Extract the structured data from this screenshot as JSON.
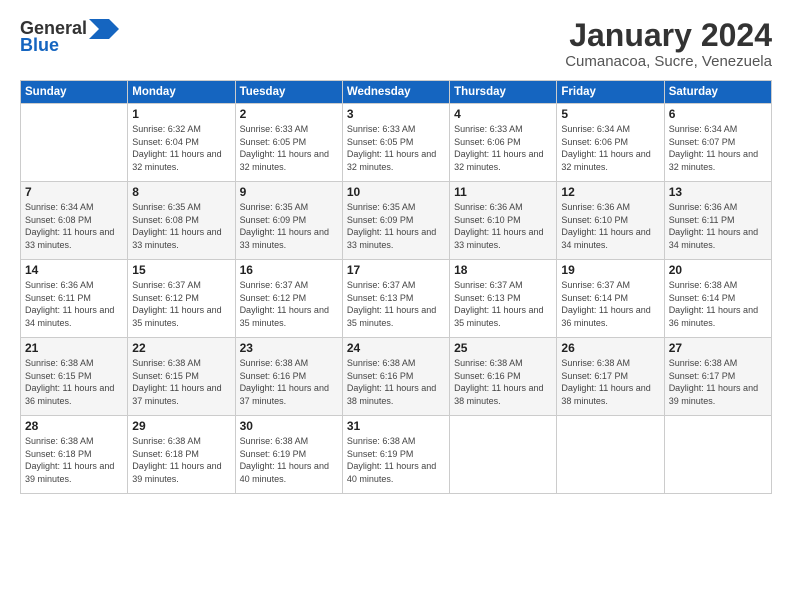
{
  "logo": {
    "general": "General",
    "blue": "Blue"
  },
  "title": "January 2024",
  "location": "Cumanacoa, Sucre, Venezuela",
  "days_of_week": [
    "Sunday",
    "Monday",
    "Tuesday",
    "Wednesday",
    "Thursday",
    "Friday",
    "Saturday"
  ],
  "weeks": [
    [
      {
        "day": "",
        "sunrise": "",
        "sunset": "",
        "daylight": ""
      },
      {
        "day": "1",
        "sunrise": "Sunrise: 6:32 AM",
        "sunset": "Sunset: 6:04 PM",
        "daylight": "Daylight: 11 hours and 32 minutes."
      },
      {
        "day": "2",
        "sunrise": "Sunrise: 6:33 AM",
        "sunset": "Sunset: 6:05 PM",
        "daylight": "Daylight: 11 hours and 32 minutes."
      },
      {
        "day": "3",
        "sunrise": "Sunrise: 6:33 AM",
        "sunset": "Sunset: 6:05 PM",
        "daylight": "Daylight: 11 hours and 32 minutes."
      },
      {
        "day": "4",
        "sunrise": "Sunrise: 6:33 AM",
        "sunset": "Sunset: 6:06 PM",
        "daylight": "Daylight: 11 hours and 32 minutes."
      },
      {
        "day": "5",
        "sunrise": "Sunrise: 6:34 AM",
        "sunset": "Sunset: 6:06 PM",
        "daylight": "Daylight: 11 hours and 32 minutes."
      },
      {
        "day": "6",
        "sunrise": "Sunrise: 6:34 AM",
        "sunset": "Sunset: 6:07 PM",
        "daylight": "Daylight: 11 hours and 32 minutes."
      }
    ],
    [
      {
        "day": "7",
        "sunrise": "Sunrise: 6:34 AM",
        "sunset": "Sunset: 6:08 PM",
        "daylight": "Daylight: 11 hours and 33 minutes."
      },
      {
        "day": "8",
        "sunrise": "Sunrise: 6:35 AM",
        "sunset": "Sunset: 6:08 PM",
        "daylight": "Daylight: 11 hours and 33 minutes."
      },
      {
        "day": "9",
        "sunrise": "Sunrise: 6:35 AM",
        "sunset": "Sunset: 6:09 PM",
        "daylight": "Daylight: 11 hours and 33 minutes."
      },
      {
        "day": "10",
        "sunrise": "Sunrise: 6:35 AM",
        "sunset": "Sunset: 6:09 PM",
        "daylight": "Daylight: 11 hours and 33 minutes."
      },
      {
        "day": "11",
        "sunrise": "Sunrise: 6:36 AM",
        "sunset": "Sunset: 6:10 PM",
        "daylight": "Daylight: 11 hours and 33 minutes."
      },
      {
        "day": "12",
        "sunrise": "Sunrise: 6:36 AM",
        "sunset": "Sunset: 6:10 PM",
        "daylight": "Daylight: 11 hours and 34 minutes."
      },
      {
        "day": "13",
        "sunrise": "Sunrise: 6:36 AM",
        "sunset": "Sunset: 6:11 PM",
        "daylight": "Daylight: 11 hours and 34 minutes."
      }
    ],
    [
      {
        "day": "14",
        "sunrise": "Sunrise: 6:36 AM",
        "sunset": "Sunset: 6:11 PM",
        "daylight": "Daylight: 11 hours and 34 minutes."
      },
      {
        "day": "15",
        "sunrise": "Sunrise: 6:37 AM",
        "sunset": "Sunset: 6:12 PM",
        "daylight": "Daylight: 11 hours and 35 minutes."
      },
      {
        "day": "16",
        "sunrise": "Sunrise: 6:37 AM",
        "sunset": "Sunset: 6:12 PM",
        "daylight": "Daylight: 11 hours and 35 minutes."
      },
      {
        "day": "17",
        "sunrise": "Sunrise: 6:37 AM",
        "sunset": "Sunset: 6:13 PM",
        "daylight": "Daylight: 11 hours and 35 minutes."
      },
      {
        "day": "18",
        "sunrise": "Sunrise: 6:37 AM",
        "sunset": "Sunset: 6:13 PM",
        "daylight": "Daylight: 11 hours and 35 minutes."
      },
      {
        "day": "19",
        "sunrise": "Sunrise: 6:37 AM",
        "sunset": "Sunset: 6:14 PM",
        "daylight": "Daylight: 11 hours and 36 minutes."
      },
      {
        "day": "20",
        "sunrise": "Sunrise: 6:38 AM",
        "sunset": "Sunset: 6:14 PM",
        "daylight": "Daylight: 11 hours and 36 minutes."
      }
    ],
    [
      {
        "day": "21",
        "sunrise": "Sunrise: 6:38 AM",
        "sunset": "Sunset: 6:15 PM",
        "daylight": "Daylight: 11 hours and 36 minutes."
      },
      {
        "day": "22",
        "sunrise": "Sunrise: 6:38 AM",
        "sunset": "Sunset: 6:15 PM",
        "daylight": "Daylight: 11 hours and 37 minutes."
      },
      {
        "day": "23",
        "sunrise": "Sunrise: 6:38 AM",
        "sunset": "Sunset: 6:16 PM",
        "daylight": "Daylight: 11 hours and 37 minutes."
      },
      {
        "day": "24",
        "sunrise": "Sunrise: 6:38 AM",
        "sunset": "Sunset: 6:16 PM",
        "daylight": "Daylight: 11 hours and 38 minutes."
      },
      {
        "day": "25",
        "sunrise": "Sunrise: 6:38 AM",
        "sunset": "Sunset: 6:16 PM",
        "daylight": "Daylight: 11 hours and 38 minutes."
      },
      {
        "day": "26",
        "sunrise": "Sunrise: 6:38 AM",
        "sunset": "Sunset: 6:17 PM",
        "daylight": "Daylight: 11 hours and 38 minutes."
      },
      {
        "day": "27",
        "sunrise": "Sunrise: 6:38 AM",
        "sunset": "Sunset: 6:17 PM",
        "daylight": "Daylight: 11 hours and 39 minutes."
      }
    ],
    [
      {
        "day": "28",
        "sunrise": "Sunrise: 6:38 AM",
        "sunset": "Sunset: 6:18 PM",
        "daylight": "Daylight: 11 hours and 39 minutes."
      },
      {
        "day": "29",
        "sunrise": "Sunrise: 6:38 AM",
        "sunset": "Sunset: 6:18 PM",
        "daylight": "Daylight: 11 hours and 39 minutes."
      },
      {
        "day": "30",
        "sunrise": "Sunrise: 6:38 AM",
        "sunset": "Sunset: 6:19 PM",
        "daylight": "Daylight: 11 hours and 40 minutes."
      },
      {
        "day": "31",
        "sunrise": "Sunrise: 6:38 AM",
        "sunset": "Sunset: 6:19 PM",
        "daylight": "Daylight: 11 hours and 40 minutes."
      },
      {
        "day": "",
        "sunrise": "",
        "sunset": "",
        "daylight": ""
      },
      {
        "day": "",
        "sunrise": "",
        "sunset": "",
        "daylight": ""
      },
      {
        "day": "",
        "sunrise": "",
        "sunset": "",
        "daylight": ""
      }
    ]
  ]
}
